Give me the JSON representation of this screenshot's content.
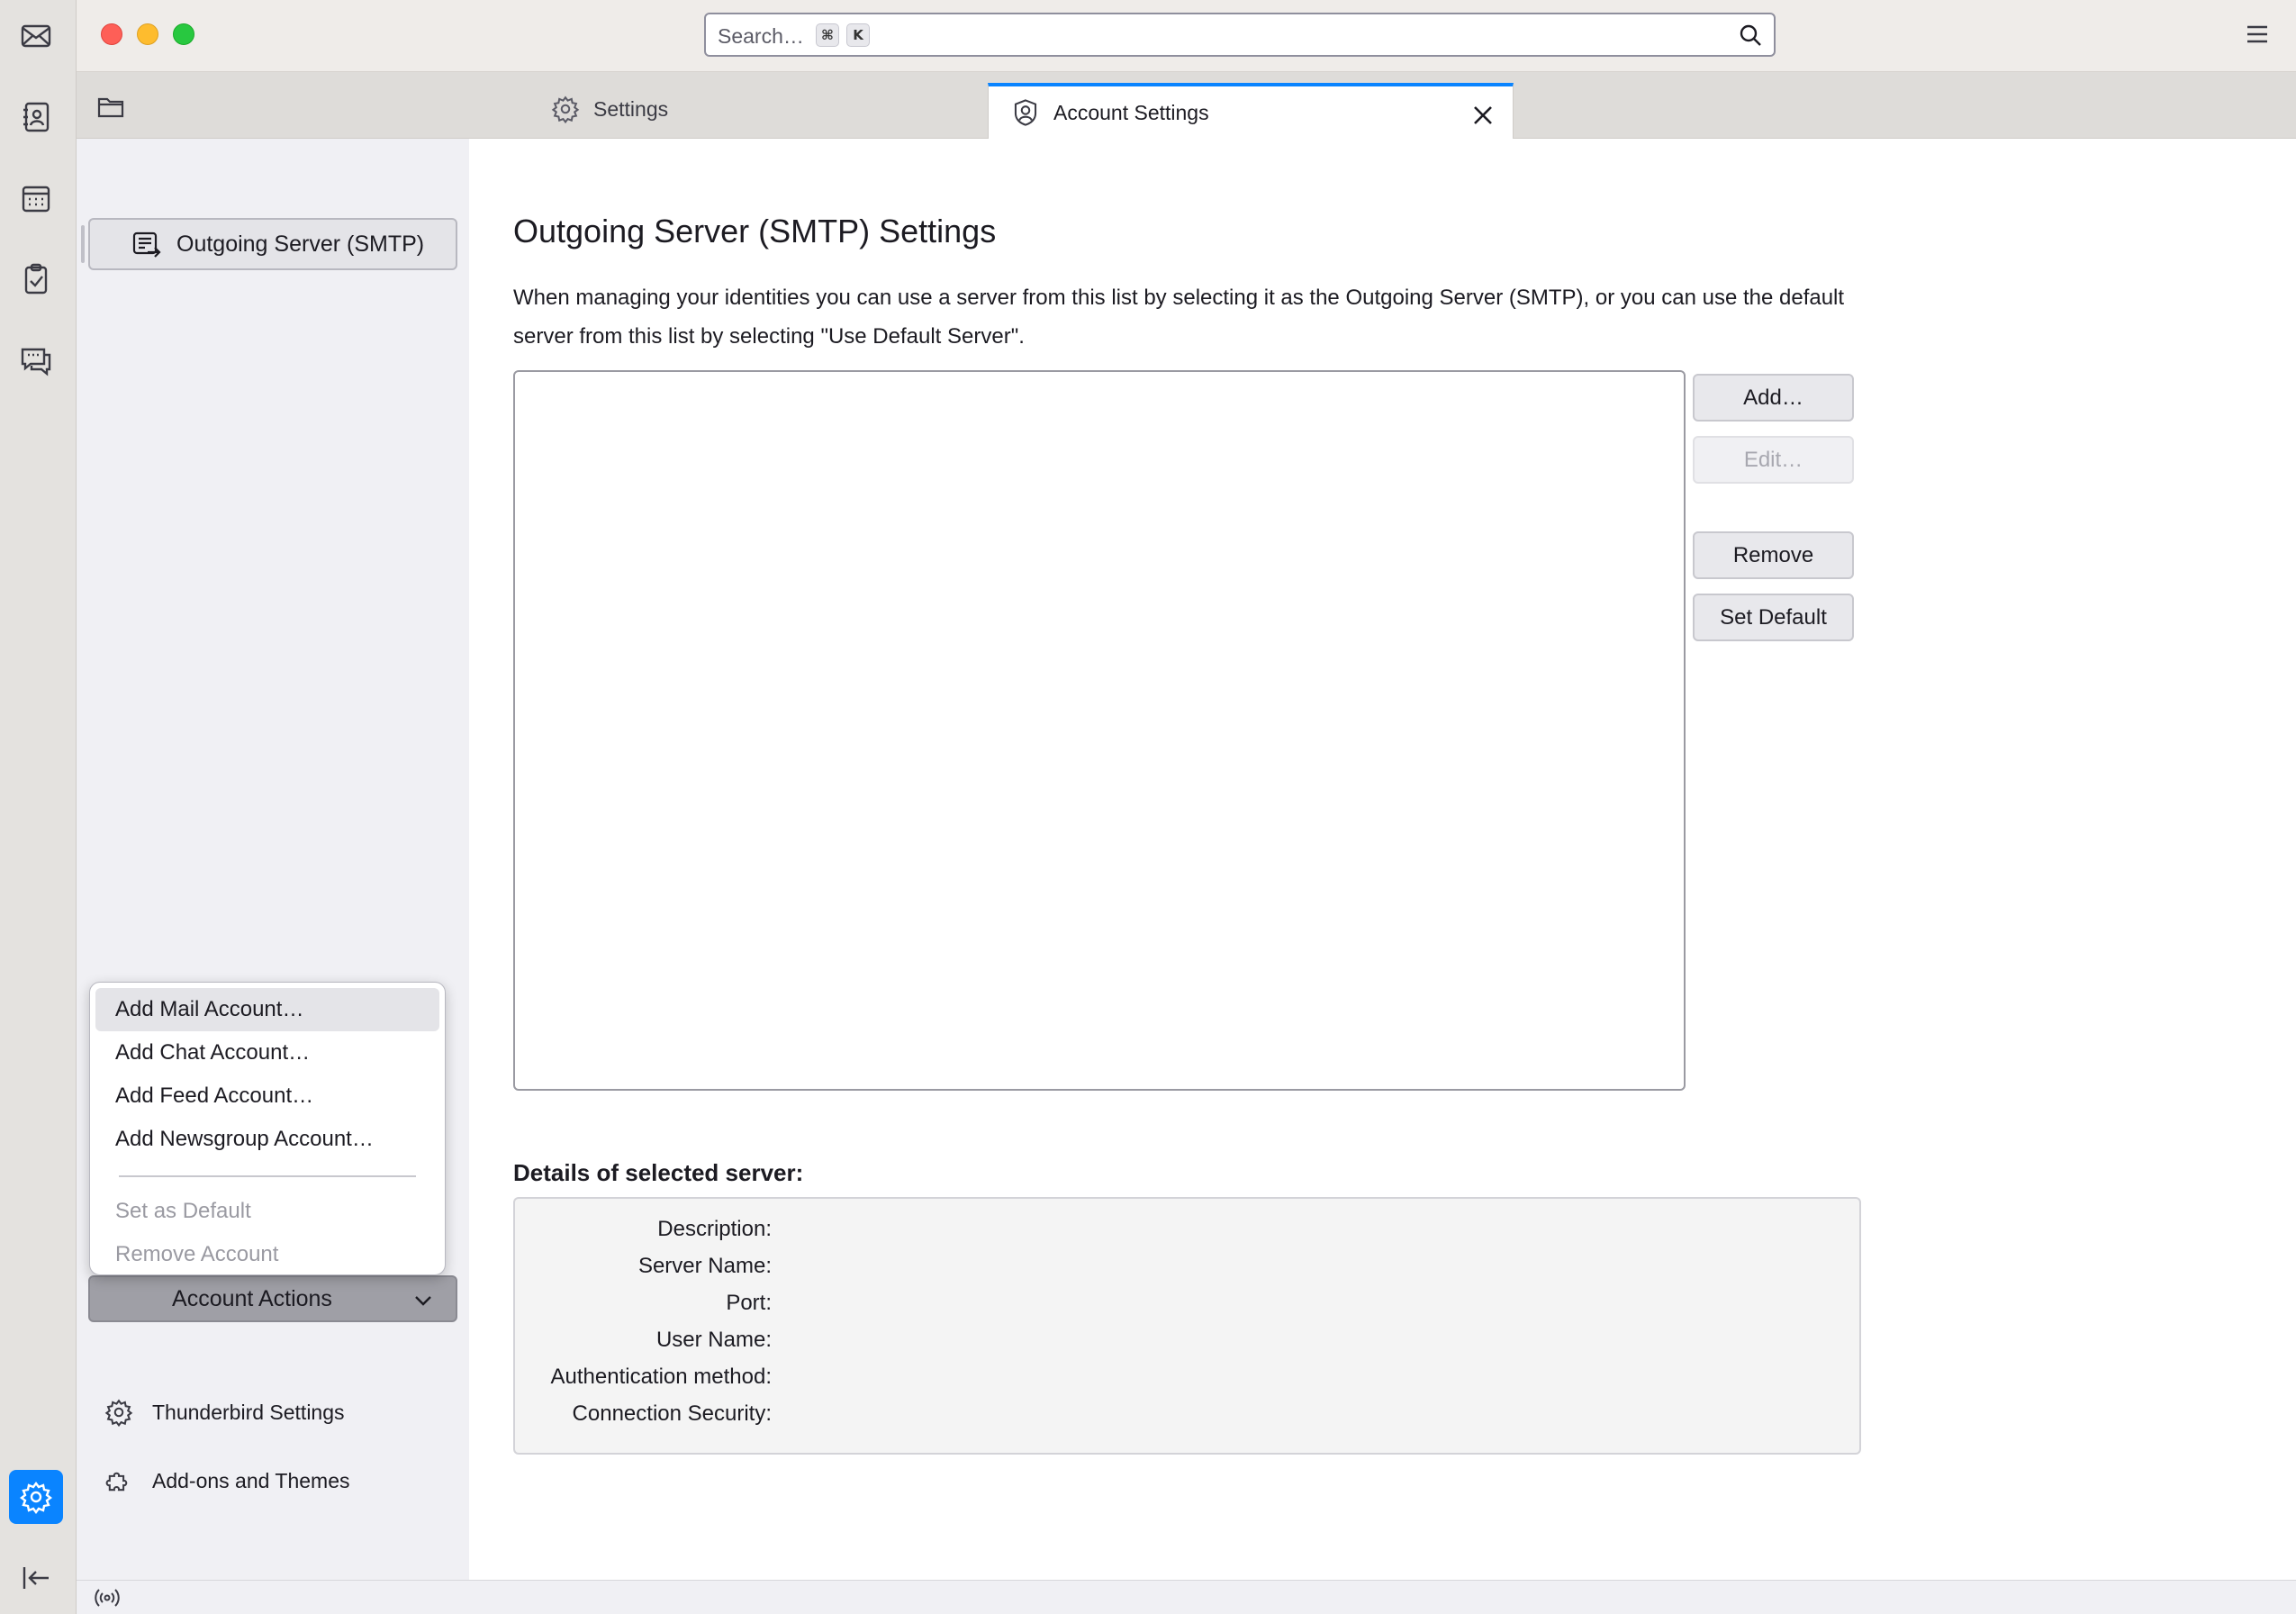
{
  "titlebar": {
    "search_placeholder": "Search…",
    "shortcut_keys": [
      "⌘",
      "K"
    ]
  },
  "spaces": {
    "items": [
      "mail-icon",
      "address-book-icon",
      "calendar-icon",
      "tasks-icon",
      "chat-icon"
    ],
    "active": "settings-icon",
    "collapse": "collapse-left-icon"
  },
  "tabs": [
    {
      "label": "Settings",
      "icon": "gear-icon",
      "active": false
    },
    {
      "label": "Account Settings",
      "icon": "account-icon",
      "active": true
    }
  ],
  "sidebar": {
    "tree_item": "Outgoing Server (SMTP)",
    "account_actions_label": "Account Actions",
    "footer_links": [
      {
        "label": "Thunderbird Settings",
        "icon": "gear-icon"
      },
      {
        "label": "Add-ons and Themes",
        "icon": "puzzle-icon"
      }
    ]
  },
  "popup_menu": {
    "items": [
      {
        "label": "Add Mail Account…",
        "state": "hover"
      },
      {
        "label": "Add Chat Account…",
        "state": "normal"
      },
      {
        "label": "Add Feed Account…",
        "state": "normal"
      },
      {
        "label": "Add Newsgroup Account…",
        "state": "normal"
      }
    ],
    "disabled_items": [
      {
        "label": "Set as Default"
      },
      {
        "label": "Remove Account"
      }
    ]
  },
  "main": {
    "title": "Outgoing Server (SMTP) Settings",
    "description": "When managing your identities you can use a server from this list by selecting it as the Outgoing Server (SMTP), or you can use the default server from this list by selecting \"Use Default Server\".",
    "buttons": {
      "add": "Add…",
      "edit": "Edit…",
      "remove": "Remove",
      "set_default": "Set Default"
    },
    "details_title": "Details of selected server:",
    "details_labels": [
      "Description:",
      "Server Name:",
      "Port:",
      "User Name:",
      "Authentication method:",
      "Connection Security:"
    ]
  },
  "colors": {
    "accent": "#0a84ff",
    "close_red": "#fe5f57",
    "minimize_yellow": "#febc2e",
    "zoom_green": "#28c840"
  }
}
